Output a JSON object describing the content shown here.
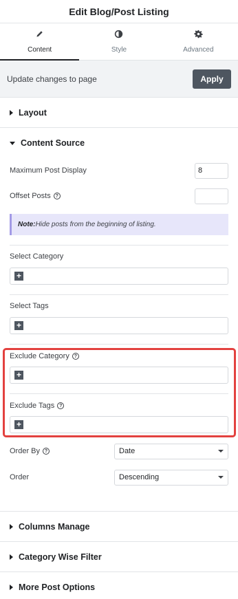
{
  "header": {
    "title": "Edit Blog/Post Listing"
  },
  "tabs": [
    {
      "label": "Content",
      "icon": "pencil-icon",
      "active": true
    },
    {
      "label": "Style",
      "icon": "contrast-icon",
      "active": false
    },
    {
      "label": "Advanced",
      "icon": "gear-icon",
      "active": false
    }
  ],
  "update": {
    "text": "Update changes to page",
    "apply_label": "Apply"
  },
  "sections": {
    "layout": "Layout",
    "content_source": "Content Source",
    "columns_manage": "Columns Manage",
    "category_wise_filter": "Category Wise Filter",
    "more_post_options": "More Post Options"
  },
  "content_source": {
    "max_post_label": "Maximum Post Display",
    "max_post_value": "8",
    "offset_label": "Offset Posts",
    "offset_value": "",
    "note_bold": "Note:",
    "note_text": " Hide posts from the beginning of listing.",
    "select_category_label": "Select Category",
    "select_tags_label": "Select Tags",
    "exclude_category_label": "Exclude Category",
    "exclude_tags_label": "Exclude Tags",
    "order_by_label": "Order By",
    "order_by_value": "Date",
    "order_label": "Order",
    "order_value": "Descending"
  },
  "colors": {
    "accent_highlight": "#e3413f",
    "note_bg": "#e7e6fa",
    "button_bg": "#4e5660"
  }
}
